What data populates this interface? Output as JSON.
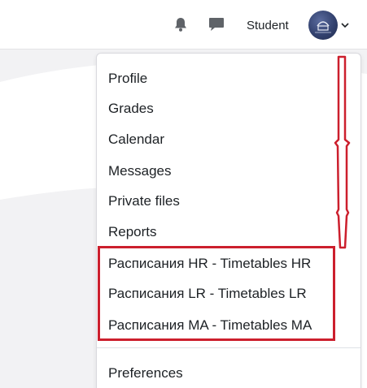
{
  "navbar": {
    "notifications_icon": "bell-icon",
    "messages_icon": "chat-icon",
    "user_name": "Student",
    "avatar": "user-avatar",
    "menu_toggle_icon": "chevron-down-icon"
  },
  "user_menu": {
    "items": [
      {
        "label": "Profile"
      },
      {
        "label": "Grades"
      },
      {
        "label": "Calendar"
      },
      {
        "label": "Messages"
      },
      {
        "label": "Private files"
      },
      {
        "label": "Reports"
      },
      {
        "label": "Расписания HR - Timetables HR"
      },
      {
        "label": "Расписания LR - Timetables LR"
      },
      {
        "label": "Расписания MA - Timetables MA"
      },
      {
        "label": "Preferences"
      }
    ]
  },
  "colors": {
    "annotation_red": "#cc1f2d",
    "text": "#1d2125",
    "icon_gray": "#5f6368"
  }
}
